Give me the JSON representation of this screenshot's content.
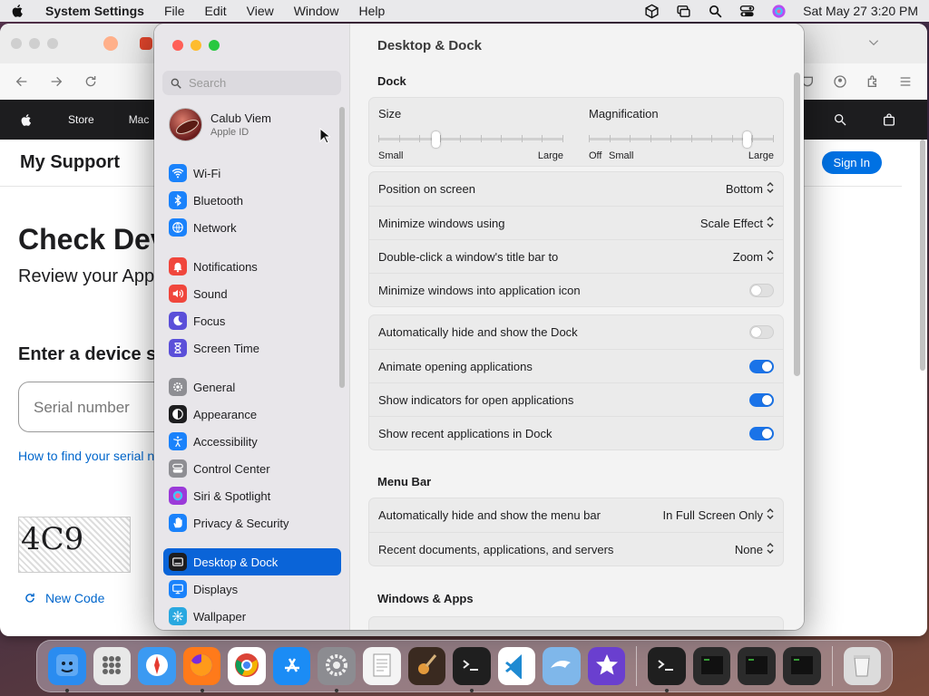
{
  "menubar": {
    "app_name": "System Settings",
    "menus": [
      "File",
      "Edit",
      "View",
      "Window",
      "Help"
    ],
    "clock": "Sat May 27  3:20 PM"
  },
  "browser": {
    "apple_nav": [
      "Store",
      "Mac"
    ],
    "support_title": "My Support",
    "sign_in": "Sign In",
    "check_heading": "Check Dev",
    "check_sub": "Review your App",
    "enter_heading": "Enter a device s",
    "serial_placeholder": "Serial number",
    "serial_link": "How to find your serial n",
    "captcha_text": "4C9",
    "new_code": "New Code"
  },
  "settings": {
    "search_placeholder": "Search",
    "account": {
      "name": "Calub Viem",
      "subtitle": "Apple ID"
    },
    "sidebar": [
      {
        "label": "Wi-Fi",
        "icon": "wifi-icon",
        "color": "#1a82fb"
      },
      {
        "label": "Bluetooth",
        "icon": "bluetooth-icon",
        "color": "#1a82fb"
      },
      {
        "label": "Network",
        "icon": "globe-icon",
        "color": "#1a82fb"
      },
      {
        "label": "Notifications",
        "icon": "bell-icon",
        "color": "#f0463c"
      },
      {
        "label": "Sound",
        "icon": "speaker-icon",
        "color": "#f0463c"
      },
      {
        "label": "Focus",
        "icon": "moon-icon",
        "color": "#5b4fd9"
      },
      {
        "label": "Screen Time",
        "icon": "hourglass-icon",
        "color": "#5b4fd9"
      },
      {
        "label": "General",
        "icon": "gear-icon",
        "color": "#8e8e93"
      },
      {
        "label": "Appearance",
        "icon": "appearance-icon",
        "color": "#1d1d1f"
      },
      {
        "label": "Accessibility",
        "icon": "accessibility-icon",
        "color": "#1a82fb"
      },
      {
        "label": "Control Center",
        "icon": "control-center-icon",
        "color": "#8e8e93"
      },
      {
        "label": "Siri & Spotlight",
        "icon": "siri-icon",
        "color": "#9b3ad9"
      },
      {
        "label": "Privacy & Security",
        "icon": "hand-icon",
        "color": "#1a82fb"
      },
      {
        "label": "Desktop & Dock",
        "icon": "dock-icon",
        "color": "#1d1d1f"
      },
      {
        "label": "Displays",
        "icon": "display-icon",
        "color": "#1a82fb"
      },
      {
        "label": "Wallpaper",
        "icon": "wallpaper-icon",
        "color": "#29a8e0"
      }
    ],
    "page_title": "Desktop & Dock",
    "dock_section": "Dock",
    "size_label": "Size",
    "size_small": "Small",
    "size_large": "Large",
    "size_value": 0.3,
    "mag_label": "Magnification",
    "mag_off": "Off",
    "mag_small": "Small",
    "mag_large": "Large",
    "mag_value": 0.87,
    "dock_rows": [
      {
        "label": "Position on screen",
        "value": "Bottom"
      },
      {
        "label": "Minimize windows using",
        "value": "Scale Effect"
      },
      {
        "label": "Double-click a window's title bar to",
        "value": "Zoom"
      },
      {
        "label": "Minimize windows into application icon",
        "toggle": false
      }
    ],
    "dock_toggles": [
      {
        "label": "Automatically hide and show the Dock",
        "on": false
      },
      {
        "label": "Animate opening applications",
        "on": true
      },
      {
        "label": "Show indicators for open applications",
        "on": true
      },
      {
        "label": "Show recent applications in Dock",
        "on": true
      }
    ],
    "menubar_section": "Menu Bar",
    "menubar_rows": [
      {
        "label": "Automatically hide and show the menu bar",
        "value": "In Full Screen Only"
      },
      {
        "label": "Recent documents, applications, and servers",
        "value": "None"
      }
    ],
    "windows_section": "Windows & Apps"
  },
  "dock": [
    {
      "name": "Finder",
      "icon": "finder-icon",
      "color": "#2a8cf0",
      "running": true
    },
    {
      "name": "Launchpad",
      "icon": "launchpad-icon",
      "color": "#e8e8e8",
      "running": false
    },
    {
      "name": "Safari",
      "icon": "safari-icon",
      "color": "#3b9af2",
      "running": false
    },
    {
      "name": "Firefox",
      "icon": "firefox-icon",
      "color": "#ff7a1a",
      "running": true
    },
    {
      "name": "Chrome",
      "icon": "chrome-icon",
      "color": "#ffffff",
      "running": false
    },
    {
      "name": "App Store",
      "icon": "appstore-icon",
      "color": "#1b8cf5",
      "running": false
    },
    {
      "name": "System Settings",
      "icon": "settings-icon",
      "color": "#8c8c91",
      "running": true
    },
    {
      "name": "TextEdit",
      "icon": "textedit-icon",
      "color": "#f4f4f4",
      "running": false
    },
    {
      "name": "GarageBand",
      "icon": "guitar-icon",
      "color": "#3a2a20",
      "running": false
    },
    {
      "name": "Terminal Monitor",
      "icon": "terminal-icon",
      "color": "#1f1f1f",
      "running": true
    },
    {
      "name": "Visual Studio Code",
      "icon": "vscode-icon",
      "color": "#ffffff",
      "running": false
    },
    {
      "name": "Dolphin",
      "icon": "dolphin-icon",
      "color": "#7fb7ea",
      "running": false
    },
    {
      "name": "iMovie",
      "icon": "star-icon",
      "color": "#6a3fcf",
      "running": false
    },
    {
      "name": "Terminal",
      "icon": "terminal-icon",
      "color": "#1f1f1f",
      "running": true
    },
    {
      "name": "Exec 1",
      "icon": "exec-icon",
      "color": "#2b2b2b",
      "running": false
    },
    {
      "name": "Exec 2",
      "icon": "exec-icon",
      "color": "#2b2b2b",
      "running": false
    },
    {
      "name": "Exec 3",
      "icon": "exec-icon",
      "color": "#2b2b2b",
      "running": false
    },
    {
      "name": "Trash",
      "icon": "trash-icon",
      "color": "#dcdcdc",
      "running": false
    }
  ]
}
